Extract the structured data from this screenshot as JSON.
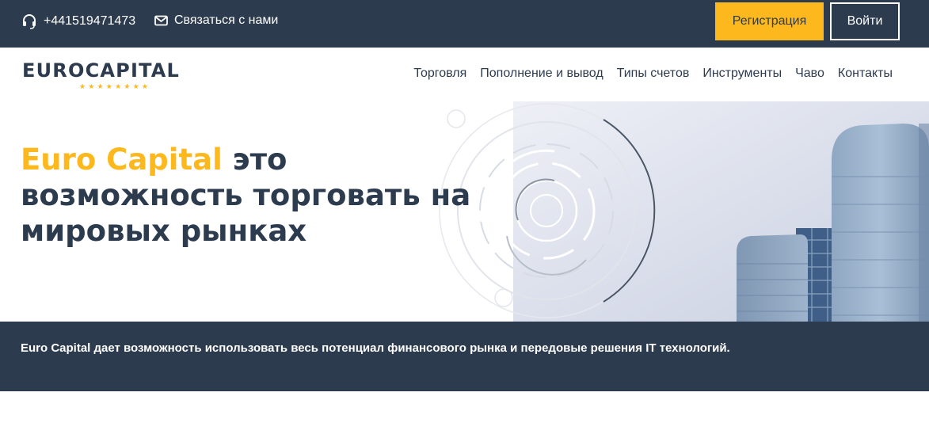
{
  "topbar": {
    "phone": "+441519471473",
    "contact_label": "Связаться с нами",
    "register_label": "Регистрация",
    "login_label": "Войти"
  },
  "logo": {
    "text": "EUROCAPITAL",
    "stars": "★★★★★★★★"
  },
  "nav": {
    "items": [
      {
        "label": "Торговля"
      },
      {
        "label": "Пополнение и вывод"
      },
      {
        "label": "Типы счетов"
      },
      {
        "label": "Инструменты"
      },
      {
        "label": "Чаво"
      },
      {
        "label": "Контакты"
      }
    ]
  },
  "hero": {
    "title_accent": "Euro Capital",
    "title_rest": " это возможность торговать на мировых рынках"
  },
  "banner": {
    "text": "Euro Capital дает возможность использовать весь потенциал финансового рынка и передовые решения IT технологий."
  },
  "colors": {
    "dark": "#2d3b4f",
    "accent": "#fdb81e",
    "white": "#ffffff"
  },
  "icons": {
    "phone": "headset-icon",
    "mail": "envelope-icon"
  }
}
